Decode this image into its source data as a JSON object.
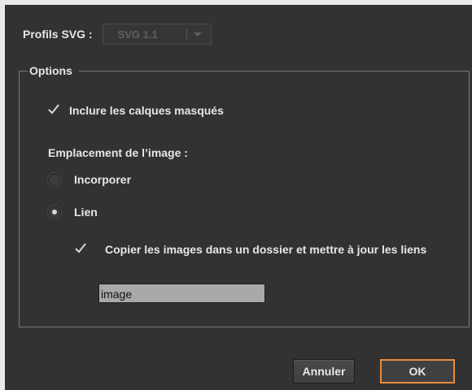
{
  "profile": {
    "label": "Profils SVG :",
    "selected": "SVG 1.1",
    "enabled": false
  },
  "options": {
    "legend": "Options",
    "include_hidden_layers": {
      "label": "Inclure les calques masqués",
      "checked": true
    },
    "image_location": {
      "label": "Emplacement de l’image :",
      "embed": {
        "label": "Incorporer",
        "selected": false
      },
      "link": {
        "label": "Lien",
        "selected": true
      }
    },
    "copy_images": {
      "label": "Copier les images dans un dossier et mettre à jour les liens",
      "checked": true
    },
    "folder_name": {
      "value": "image"
    }
  },
  "buttons": {
    "cancel": "Annuler",
    "ok": "OK"
  },
  "colors": {
    "dialog_background": "#323232",
    "default_button_border": "#e98b3e",
    "text": "#e6e6e6"
  },
  "icons": {
    "checkmark": "checkmark-icon",
    "dropdown": "chevron-down-icon"
  }
}
